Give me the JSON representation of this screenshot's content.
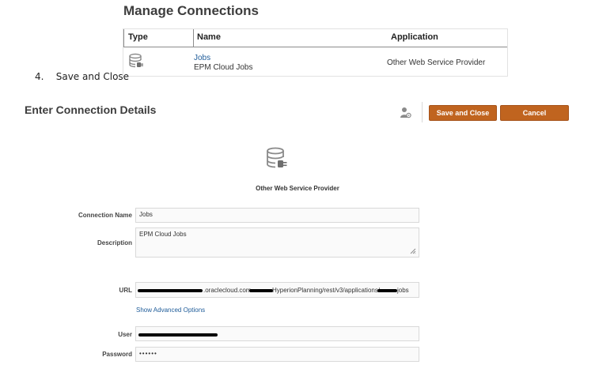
{
  "manage": {
    "title": "Manage Connections",
    "columns": [
      "Type",
      "Name",
      "Application"
    ],
    "row": {
      "icon": "database-plug-icon",
      "name_link": "Jobs",
      "name_sub": "EPM Cloud Jobs",
      "application": "Other Web Service Provider"
    }
  },
  "step": {
    "number": "4.",
    "text": "Save and Close"
  },
  "details": {
    "title": "Enter Connection Details",
    "save_label": "Save and Close",
    "cancel_label": "Cancel",
    "provider": "Other Web Service Provider",
    "fields": {
      "connection_name": {
        "label": "Connection Name",
        "value": "Jobs"
      },
      "description": {
        "label": "Description",
        "value": "EPM Cloud Jobs"
      },
      "url": {
        "label": "URL",
        "visible_parts": [
          ".oraclecloud.com",
          "HyperionPlanning/rest/v3/applications/",
          "jobs"
        ]
      },
      "user": {
        "label": "User"
      },
      "password": {
        "label": "Password",
        "value": "••••••"
      }
    },
    "advanced_link": "Show Advanced Options"
  },
  "colors": {
    "button": "#c0641f",
    "link": "#1f5c99"
  }
}
